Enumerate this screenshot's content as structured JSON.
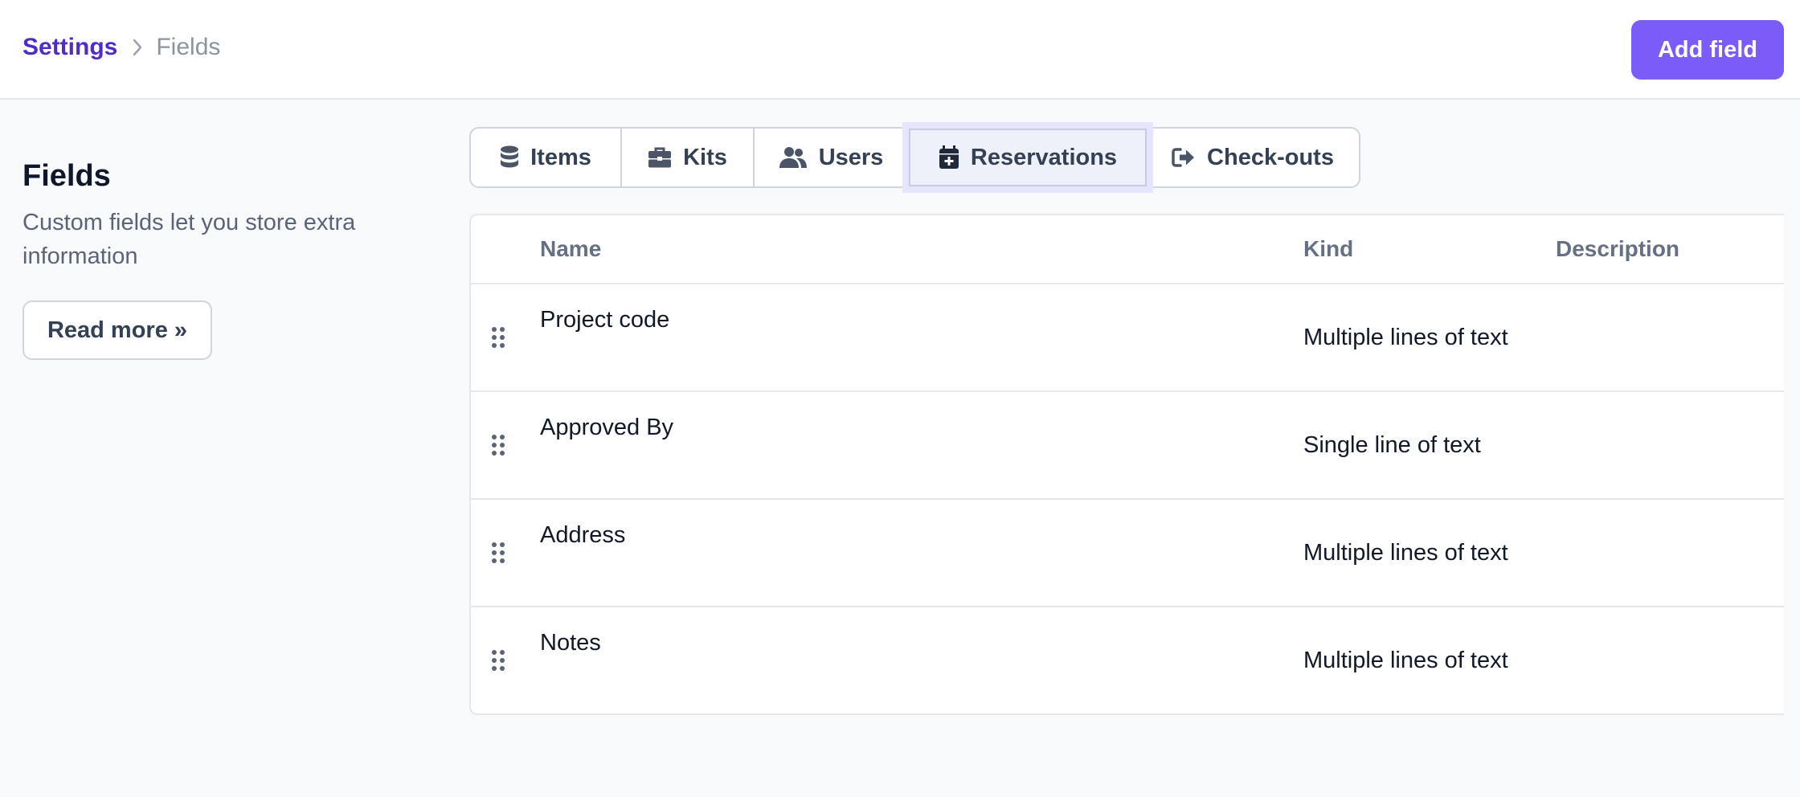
{
  "breadcrumb": {
    "parent": "Settings",
    "current": "Fields"
  },
  "header": {
    "add_button_label": "Add field"
  },
  "left_panel": {
    "title": "Fields",
    "description": "Custom fields let you store extra information",
    "read_more_label": "Read more »"
  },
  "tabs": [
    {
      "label": "Items",
      "icon": "database-icon",
      "active": false
    },
    {
      "label": "Kits",
      "icon": "briefcase-icon",
      "active": false
    },
    {
      "label": "Users",
      "icon": "users-icon",
      "active": false
    },
    {
      "label": "Reservations",
      "icon": "calendar-plus-icon",
      "active": true
    },
    {
      "label": "Check-outs",
      "icon": "sign-out-icon",
      "active": false
    }
  ],
  "table": {
    "columns": [
      "Name",
      "Kind",
      "Description"
    ],
    "rows": [
      {
        "name": "Project code",
        "kind": "Multiple lines of text",
        "description": ""
      },
      {
        "name": "Approved By",
        "kind": "Single line of text",
        "description": ""
      },
      {
        "name": "Address",
        "kind": "Multiple lines of text",
        "description": ""
      },
      {
        "name": "Notes",
        "kind": "Multiple lines of text",
        "description": ""
      }
    ]
  },
  "colors": {
    "accent": "#7c5cf8",
    "breadcrumb_link": "#4f2cc9",
    "active_tab_bg": "#eef0fa"
  }
}
